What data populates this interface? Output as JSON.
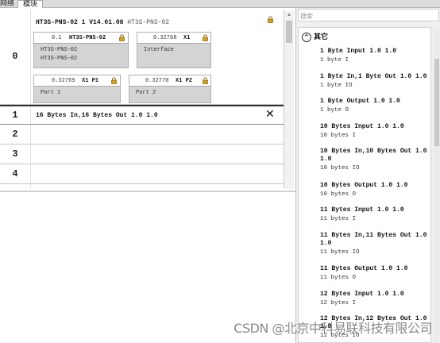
{
  "tabs": [
    "网络",
    "模块"
  ],
  "head": {
    "name": "HT3S-PNS-02",
    "slot_info": "1 V14.01.08",
    "type": "HT3S-PNS-02"
  },
  "module_boxes": [
    {
      "id": "0.1",
      "name": "HT3S-PNS-02",
      "lines": [
        "HT3S-PNS-02",
        "HT3S-PNS-02"
      ]
    },
    {
      "id": "0.32768",
      "name": "X1",
      "lines": [
        "Interface"
      ]
    },
    {
      "id": "0.32769",
      "name": "X1 P1",
      "lines": [
        "Port 1"
      ]
    },
    {
      "id": "0.32770",
      "name": "X1 P2",
      "lines": [
        "Port 2"
      ]
    }
  ],
  "slots": [
    {
      "num": "0"
    },
    {
      "num": "1",
      "module": "16 Bytes In,16 Bytes Out 1.0 1.0"
    },
    {
      "num": "2"
    },
    {
      "num": "3"
    },
    {
      "num": "4"
    }
  ],
  "catalog": {
    "search_placeholder": "搜索",
    "group_label": "其它",
    "items": [
      {
        "name": "1 Byte Input 1.0 1.0",
        "sub": "1 byte I"
      },
      {
        "name": "1 Byte In,1 Byte Out 1.0 1.0",
        "sub": "1 byte IO"
      },
      {
        "name": "1 Byte Output 1.0 1.0",
        "sub": "1 byte O"
      },
      {
        "name": "10 Bytes Input 1.0 1.0",
        "sub": "10 bytes I"
      },
      {
        "name": "10 Bytes In,10 Bytes Out 1.0 1.0",
        "sub": "10 bytes IO"
      },
      {
        "name": "10 Bytes Output 1.0 1.0",
        "sub": "10 bytes O"
      },
      {
        "name": "11 Bytes Input 1.0 1.0",
        "sub": "11 bytes I"
      },
      {
        "name": "11 Bytes In,11 Bytes Out 1.0 1.0",
        "sub": "11 bytes IO"
      },
      {
        "name": "11 Bytes Output 1.0 1.0",
        "sub": "11 bytes O"
      },
      {
        "name": "12 Bytes Input 1.0 1.0",
        "sub": "12 bytes I"
      },
      {
        "name": "12 Bytes In,12 Bytes Out 1.0 1.0",
        "sub": "12 bytes IO"
      }
    ]
  },
  "watermark": "CSDN @北京中科易联科技有限公司",
  "colors": {
    "lock": "#d6a21c",
    "watermark": "#444444"
  }
}
